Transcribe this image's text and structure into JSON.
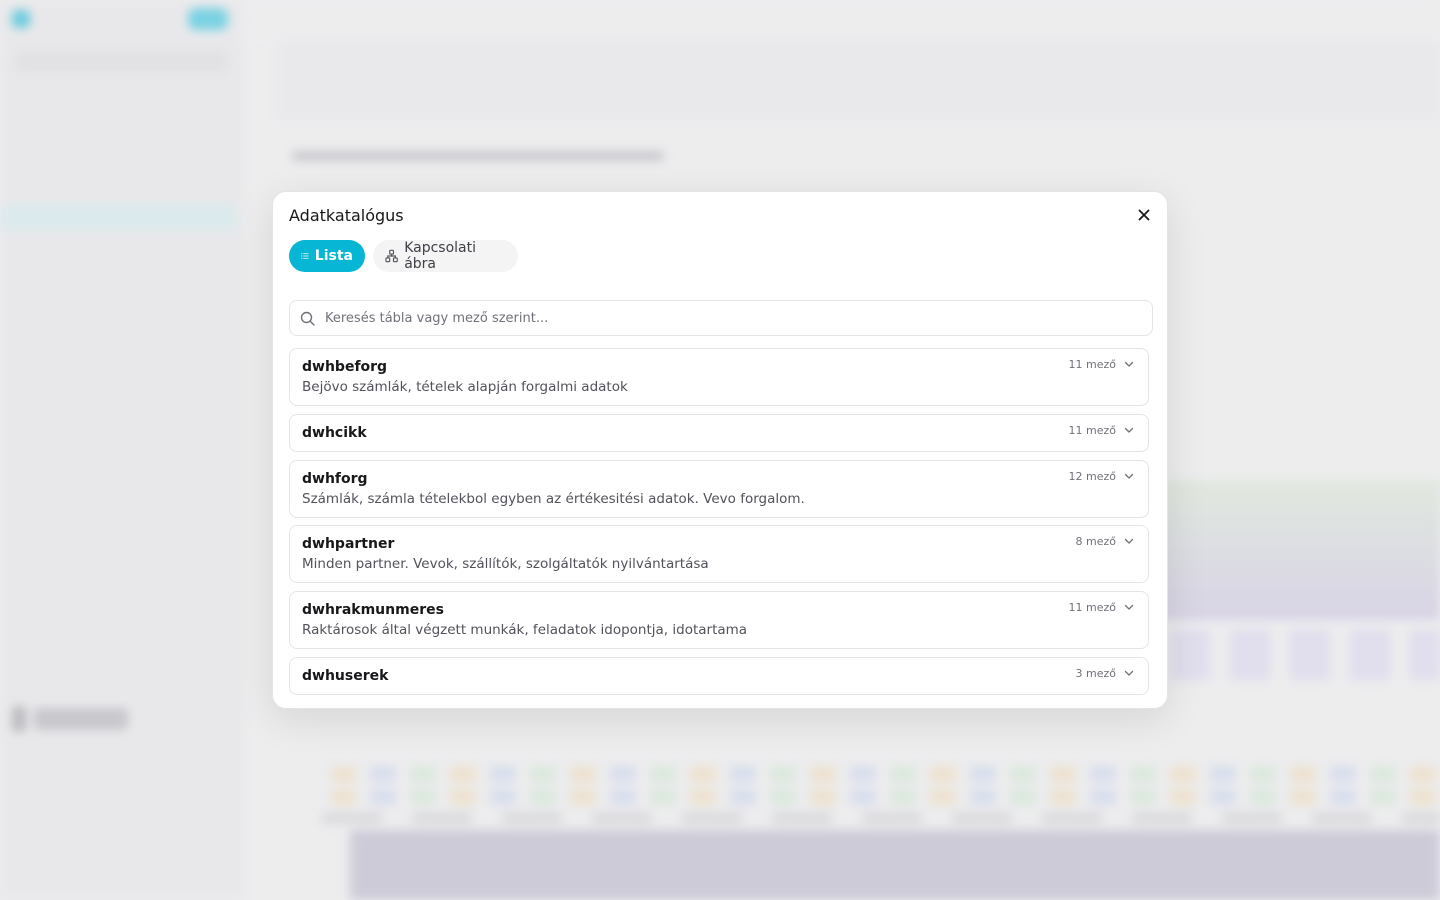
{
  "modal": {
    "title": "Adatkatalógus",
    "close_icon": "close-icon",
    "tabs": [
      {
        "label": "Lista",
        "icon": "list-icon",
        "active": true
      },
      {
        "label": "Kapcsolati ábra",
        "icon": "network-icon",
        "active": false
      }
    ],
    "search": {
      "placeholder": "Keresés tábla vagy mező szerint..."
    },
    "tables": [
      {
        "name": "dwhbeforg",
        "description": "Bejövo számlák, tételek alapján forgalmi adatok",
        "field_count": "11 mező"
      },
      {
        "name": "dwhcikk",
        "description": "",
        "field_count": "11 mező"
      },
      {
        "name": "dwhforg",
        "description": "Számlák, számla tételekbol egyben az értékesitési adatok. Vevo forgalom.",
        "field_count": "12 mező"
      },
      {
        "name": "dwhpartner",
        "description": "Minden partner. Vevok, szállítók, szolgáltatók nyilvántartása",
        "field_count": "8 mező"
      },
      {
        "name": "dwhrakmunmeres",
        "description": "Raktárosok által végzett munkák, feladatok idopontja, idotartama",
        "field_count": "11 mező"
      },
      {
        "name": "dwhuserek",
        "description": "",
        "field_count": "3 mező"
      }
    ]
  },
  "colors": {
    "accent": "#06b6d4",
    "border": "#e4e4e7",
    "muted_text": "#52525b"
  }
}
